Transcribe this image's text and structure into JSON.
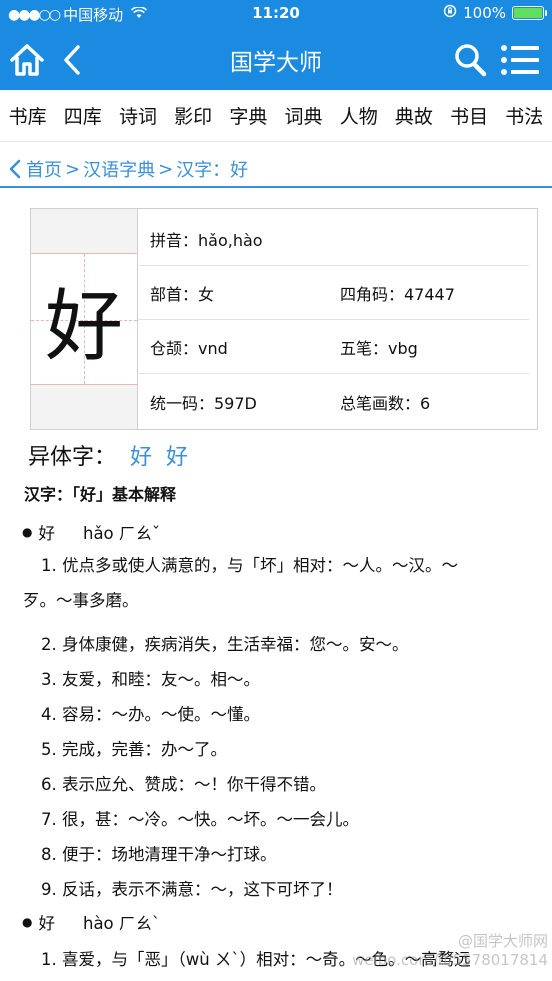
{
  "statusbar": {
    "carrier": "中国移动",
    "time": "11:20",
    "battery": "100%"
  },
  "navbar": {
    "title": "国学大师"
  },
  "categories": [
    "书库",
    "四库",
    "诗词",
    "影印",
    "字典",
    "词典",
    "人物",
    "典故",
    "书目",
    "书法"
  ],
  "breadcrumb": {
    "home": "首页",
    "sep1": ">",
    "dict": "汉语字典",
    "sep2": ">",
    "current": "汉字：好"
  },
  "char_card": {
    "character": "好",
    "pinyin": "拼音：hǎo,hào",
    "radical": "部首：女",
    "four_corner": "四角码：47447",
    "cangjie": "仓颉：vnd",
    "wubi": "五笔：vbg",
    "unicode": "统一码：597D",
    "strokes": "总笔画数：6"
  },
  "variants": {
    "label": "异体字：",
    "items": [
      "好",
      "好"
    ]
  },
  "section_title": "汉字：「好」基本解释",
  "entries": [
    {
      "bullet": "●",
      "char": "好",
      "pinyin": "hǎo ㄏㄠˇ",
      "senses": [
        {
          "line1": "1. 优点多或使人满意的，与「坏」相对：～人。～汉。～",
          "line2": "歹。～事多磨。"
        },
        {
          "line1": "2. 身体康健，疾病消失，生活幸福：您～。安～。"
        },
        {
          "line1": "3. 友爱，和睦：友～。相～。"
        },
        {
          "line1": "4. 容易：～办。～使。～懂。"
        },
        {
          "line1": "5. 完成，完善：办～了。"
        },
        {
          "line1": "6. 表示应允、赞成：～！你干得不错。"
        },
        {
          "line1": "7. 很，甚：～冷。～快。～坏。～一会儿。"
        },
        {
          "line1": "8. 便于：场地清理干净～打球。"
        },
        {
          "line1": "9. 反话，表示不满意：～，这下可坏了！"
        }
      ]
    },
    {
      "bullet": "●",
      "char": "好",
      "pinyin": "hào ㄏㄠˋ",
      "senses": [
        {
          "line1": "1. 喜爱，与「恶」（wù ㄨˋ）相对：～奇。～色。～高骛远"
        }
      ]
    }
  ],
  "watermark": {
    "line1": "@国学大师网",
    "line2": "weibo.com/u/5578017814"
  },
  "colors": {
    "primary": "#1a8be0",
    "link": "#3a8fd8",
    "battery": "#5ee05e"
  }
}
